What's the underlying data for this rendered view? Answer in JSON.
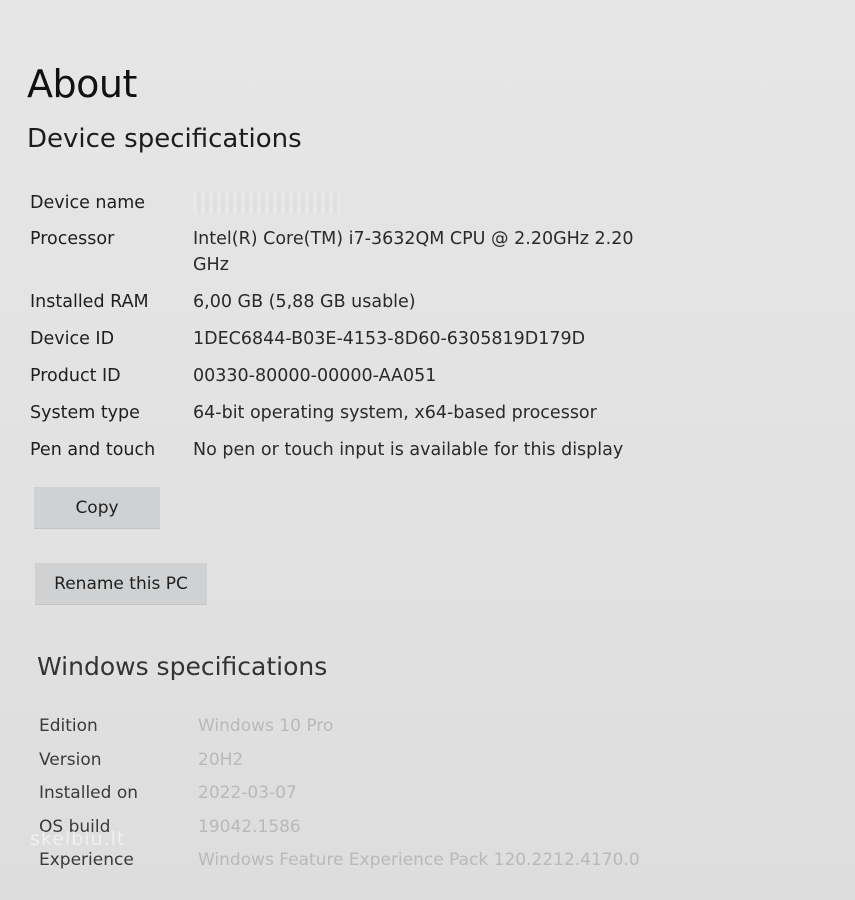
{
  "about": {
    "title": "About"
  },
  "device": {
    "heading": "Device specifications",
    "specs": [
      {
        "label": "Device name",
        "value": ""
      },
      {
        "label": "Processor",
        "value": "Intel(R) Core(TM) i7-3632QM CPU @ 2.20GHz   2.20 GHz"
      },
      {
        "label": "Installed RAM",
        "value": "6,00 GB (5,88 GB usable)"
      },
      {
        "label": "Device ID",
        "value": "1DEC6844-B03E-4153-8D60-6305819D179D"
      },
      {
        "label": "Product ID",
        "value": "00330-80000-00000-AA051"
      },
      {
        "label": "System type",
        "value": "64-bit operating system, x64-based processor"
      },
      {
        "label": "Pen and touch",
        "value": "No pen or touch input is available for this display"
      }
    ],
    "copy_label": "Copy",
    "rename_label": "Rename this PC"
  },
  "windows": {
    "heading": "Windows specifications",
    "specs": [
      {
        "label": "Edition",
        "value": "Windows 10 Pro"
      },
      {
        "label": "Version",
        "value": "20H2"
      },
      {
        "label": "Installed on",
        "value": "2022-03-07"
      },
      {
        "label": "OS build",
        "value": "19042.1586"
      },
      {
        "label": "Experience",
        "value": "Windows Feature Experience Pack 120.2212.4170.0"
      }
    ]
  },
  "watermark": "skelbiu.lt"
}
